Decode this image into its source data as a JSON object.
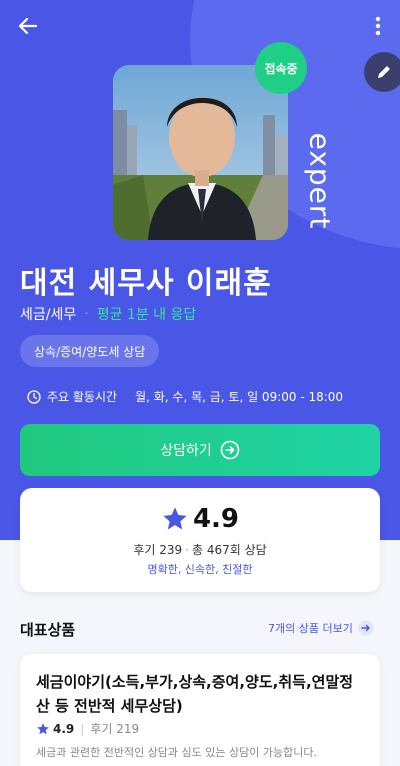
{
  "colors": {
    "primary": "#4a57e6",
    "accent_green": "#1fcf86",
    "response_green": "#37e3a1",
    "star": "#4a57e6"
  },
  "header": {
    "back_icon": "arrow-left-icon",
    "more_icon": "more-vertical-icon",
    "edit_icon": "pencil-icon"
  },
  "profile": {
    "online_badge": "접속중",
    "brand_text": "expert",
    "name": "대전 세무사 이래훈",
    "category": "세금/세무",
    "response_time": "평균 1분 내 응답",
    "tag": "상속/증여/양도세 상담",
    "hours_label": "주요 활동시간",
    "hours_value": "월, 화, 수, 목, 금, 토, 일  09:00 - 18:00"
  },
  "cta": {
    "label": "상담하기"
  },
  "rating": {
    "score": "4.9",
    "reviews": "후기 239",
    "consults": "총 467회 상담",
    "traits": "명확한, 신속한, 친절한"
  },
  "products_section": {
    "title": "대표상품",
    "more_link": "7개의 상품 더보기"
  },
  "product": {
    "title": "세금이야기(소득,부가,상속,증여,양도,취득,연말정산 등 전반적 세무상담)",
    "score": "4.9",
    "reviews": "후기 219",
    "description": "세금과 관련한 전반적인 상담과 심도 있는 상담이 가능합니다."
  }
}
